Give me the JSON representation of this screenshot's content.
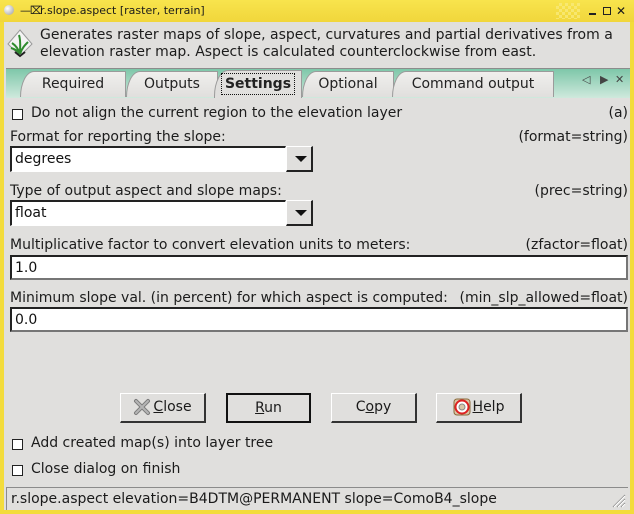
{
  "window": {
    "title": "r.slope.aspect [raster, terrain]",
    "controls": [
      "minimize",
      "maximize",
      "close"
    ]
  },
  "header": {
    "description_line1": "Generates raster maps of slope, aspect, curvatures and partial derivatives from a",
    "description_line2": "elevation raster map. Aspect is calculated counterclockwise from east.",
    "logo_icon": "grass-logo-icon"
  },
  "tabs": {
    "items": [
      {
        "label": "Required",
        "active": false
      },
      {
        "label": "Outputs",
        "active": false
      },
      {
        "label": "Settings",
        "active": true
      },
      {
        "label": "Optional",
        "active": false
      },
      {
        "label": "Command output",
        "active": false
      }
    ],
    "nav_prev": "◁",
    "nav_next": "▶",
    "nav_close": "✕"
  },
  "settings": {
    "align": {
      "label": "Do not align the current region to the elevation layer",
      "param": "(a)",
      "checked": false
    },
    "format": {
      "label": "Format for reporting the slope:",
      "param": "(format=string)",
      "value": "degrees"
    },
    "prec": {
      "label": "Type of output aspect and slope maps:",
      "param": "(prec=string)",
      "value": "float"
    },
    "zfactor": {
      "label": "Multiplicative factor to convert elevation units to meters:",
      "param": "(zfactor=float)",
      "value": "1.0"
    },
    "min_slp": {
      "label": "Minimum slope val. (in percent) for which aspect is computed:",
      "param": "(min_slp_allowed=float)",
      "value": "0.0"
    }
  },
  "buttons": {
    "close": {
      "label": "Close",
      "mnemonic": "C",
      "rest": "lose"
    },
    "run": {
      "label": "Run",
      "mnemonic": "R",
      "rest": "un"
    },
    "copy": {
      "label": "Copy",
      "pre": "C",
      "mnemonic": "o",
      "rest": "py"
    },
    "help": {
      "label": "Help",
      "mnemonic": "H",
      "rest": "elp"
    }
  },
  "options": {
    "add_layer": {
      "label": "Add created map(s) into layer tree",
      "checked": false
    },
    "close_on_finish": {
      "label": "Close dialog on finish",
      "checked": false
    }
  },
  "statusbar": {
    "command": "r.slope.aspect elevation=B4DTM@PERMANENT slope=ComoB4_slope"
  }
}
